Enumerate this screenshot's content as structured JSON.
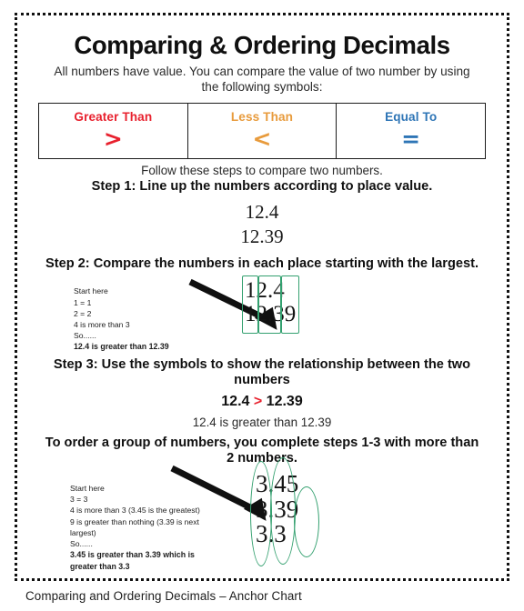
{
  "chart": {
    "title": "Comparing & Ordering Decimals",
    "subtitle": "All numbers have value. You can compare the value of two number by using the following symbols:",
    "caption": "Comparing and Ordering Decimals – Anchor Chart"
  },
  "colors": {
    "greater_than": "#E8212E",
    "less_than": "#E89B3C",
    "equal_to": "#2E75B6",
    "annotation_green": "#33a06f",
    "text": "#111111",
    "border": "#111111"
  },
  "symbols_table": {
    "columns": [
      {
        "label": "Greater Than",
        "glyph": ">",
        "color": "#E8212E"
      },
      {
        "label": "Less Than",
        "glyph": "<",
        "color": "#E89B3C"
      },
      {
        "label": "Equal To",
        "glyph": "=",
        "color": "#2E75B6"
      }
    ]
  },
  "intro_line": "Follow these steps to compare two numbers.",
  "steps": [
    {
      "heading": "Step 1:  Line up the numbers according to place value.",
      "numbers": [
        "12.4",
        "12.39"
      ]
    },
    {
      "heading": "Step 2: Compare the numbers in each place starting with the largest.",
      "notes": [
        "Start here",
        "1 = 1",
        "2 = 2",
        "4 is more than 3",
        "So......"
      ],
      "notes_bold": "12.4 is greater than 12.39",
      "numbers": [
        "12.4",
        "12.39"
      ]
    },
    {
      "heading": "Step 3: Use the symbols to show the relationship between the two numbers",
      "comparison_left": "12.4",
      "comparison_symbol": ">",
      "comparison_right": "12.39",
      "explanation": "12.4 is greater than 12.39"
    }
  ],
  "ordering": {
    "heading": "To order a group of numbers, you complete steps 1-3 with more than 2 numbers.",
    "notes": [
      "Start here",
      "3 = 3",
      "4 is more than 3 (3.45 is the greatest)",
      "9 is greater than nothing (3.39 is next",
      "largest)",
      "So......"
    ],
    "notes_bold_1": "3.45 is greater than 3.39 which is",
    "notes_bold_2": "greater than 3.3",
    "numbers": [
      "3.45",
      "3.39",
      "3.3"
    ]
  }
}
